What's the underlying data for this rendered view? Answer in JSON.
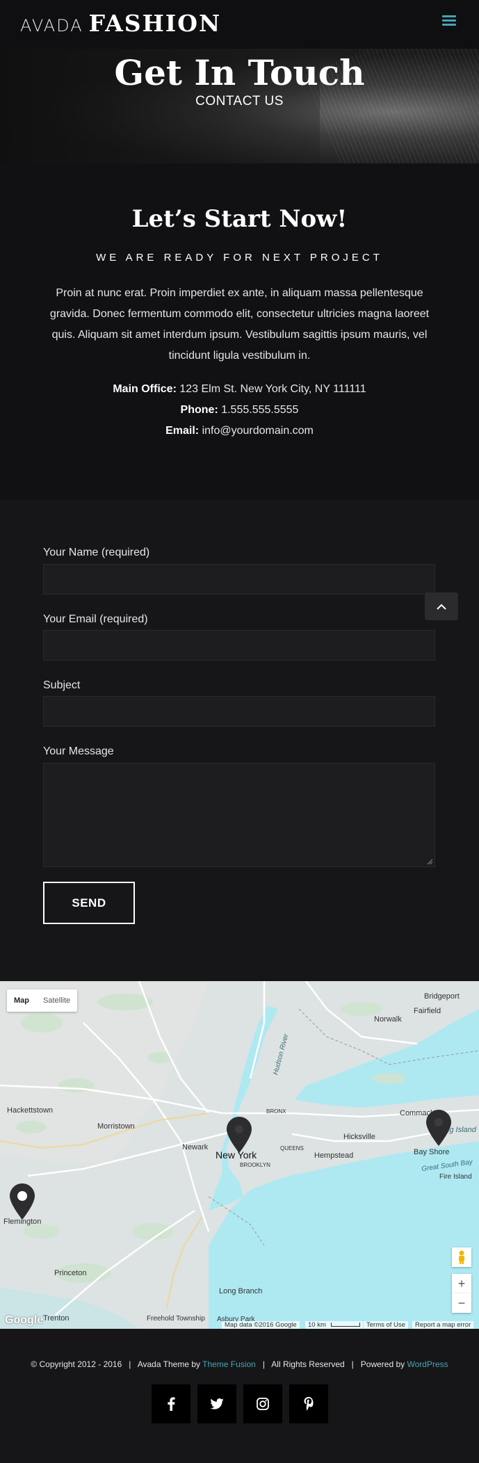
{
  "header": {
    "logo_light": "AVADA",
    "logo_bold": "FASHION",
    "menu_icon": "hamburger-icon",
    "accent_color": "#46a5b5"
  },
  "hero": {
    "title": "Get In Touch",
    "subtitle": "CONTACT US"
  },
  "intro": {
    "title": "Let’s Start Now!",
    "tagline": "WE ARE READY FOR NEXT PROJECT",
    "text": "Proin at nunc erat. Proin imperdiet ex ante, in aliquam massa pellentesque gravida. Donec fermentum commodo elit, consectetur ultricies magna laoreet quis. Aliquam sit amet interdum ipsum. Vestibulum sagittis ipsum mauris, vel tincidunt ligula vestibulum in.",
    "office_label": "Main Office:",
    "office_value": " 123 Elm St. New York City, NY 111111",
    "phone_label": "Phone:",
    "phone_value": " 1.555.555.5555",
    "email_label": "Email:",
    "email_value": " info@yourdomain.com"
  },
  "form": {
    "name_label": "Your Name (required)",
    "email_label": "Your Email (required)",
    "subject_label": "Subject",
    "message_label": "Your Message",
    "name_value": "",
    "email_value": "",
    "subject_value": "",
    "message_value": "",
    "send_label": "SEND",
    "to_top_icon": "chevron-up-icon"
  },
  "map": {
    "type_map": "Map",
    "type_satellite": "Satellite",
    "labels": {
      "bridgeport": "Bridgeport",
      "fairfield": "Fairfield",
      "norwalk": "Norwalk",
      "hackettstown": "Hackettstown",
      "morristown": "Morristown",
      "newark": "Newark",
      "new_york": "New York",
      "brooklyn": "BROOKLYN",
      "bronx": "BRONX",
      "queens": "QUEENS",
      "hempstead": "Hempstead",
      "hicksville": "Hicksville",
      "commack": "Commack",
      "bay_shore": "Bay Shore",
      "long_island": "Long Island",
      "fire_island": "Fire Island",
      "great_south_bay": "Great South Bay",
      "flemington": "Flemington",
      "princeton": "Princeton",
      "long_branch": "Long Branch",
      "freehold_township": "Freehold Township",
      "asbury_park": "Asbury Park",
      "hudson_river": "Hudson River",
      "trenton": "Trenton"
    },
    "attribution_data": "Map data ©2016 Google",
    "attribution_scale": "10 km",
    "attribution_terms": "Terms of Use",
    "attribution_report": "Report a map error",
    "google": "Google",
    "zoom_in": "+",
    "zoom_out": "−"
  },
  "footer": {
    "copyright_prefix": "© Copyright 2012 - 2016   |   Avada Theme by ",
    "theme_link": "Theme Fusion",
    "copyright_middle": "   |   All Rights Reserved   |   Powered by ",
    "wordpress_link": "WordPress",
    "socials": [
      "facebook-icon",
      "twitter-icon",
      "instagram-icon",
      "pinterest-icon"
    ]
  }
}
